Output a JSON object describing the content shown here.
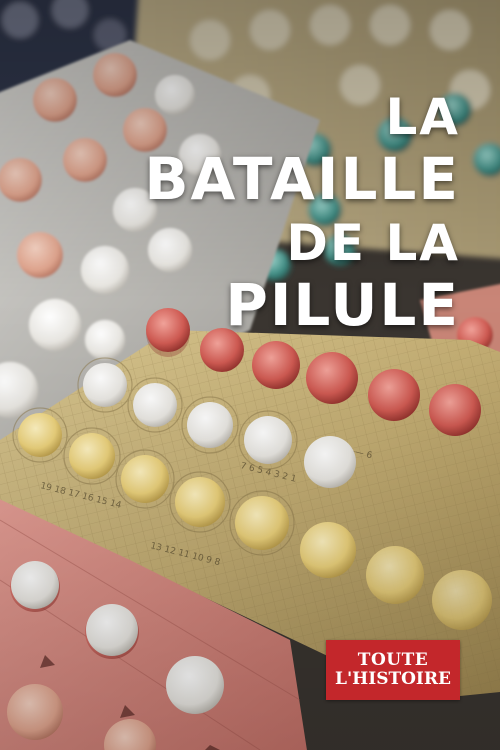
{
  "title": {
    "line1": "LA",
    "line2": "BATAILLE",
    "line3": "DE LA",
    "line4": "PILULE"
  },
  "logo": {
    "line1": "TOUTE",
    "line2": "L'HISTOIRE",
    "color": "#c3272b"
  },
  "colors": {
    "gold_foil": "#c9b57e",
    "pink_foil": "#d98a84",
    "silver_foil": "#b8b7b3",
    "pill_white": "#f2f0ec",
    "pill_yellow": "#ecd27c",
    "pill_red": "#c9504a",
    "pill_teal": "#3f8f86"
  }
}
